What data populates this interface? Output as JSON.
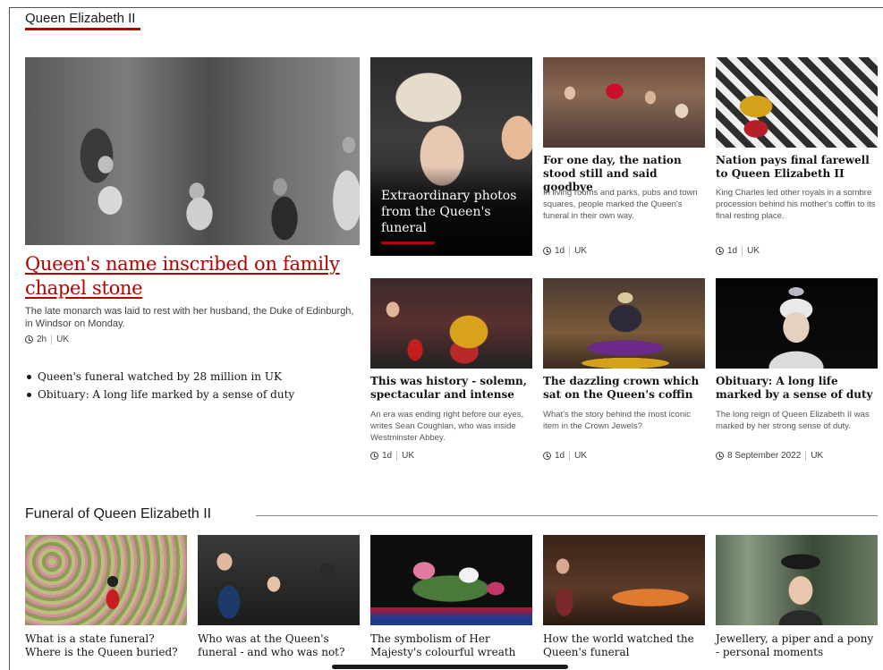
{
  "section": {
    "title": "Queen Elizabeth II"
  },
  "lead": {
    "headline": "Queen's name inscribed on family chapel stone",
    "summary": "The late monarch was laid to rest with her husband, the Duke of Edinburgh, in Windsor on Monday.",
    "time": "2h",
    "tag": "UK",
    "related": [
      "Queen's funeral watched by 28 million in UK",
      "Obituary: A long life marked by a sense of duty"
    ]
  },
  "feature": {
    "title": "Extraordinary photos from the Queen's funeral"
  },
  "cards": [
    {
      "title": "For one day, the nation stood still and said goodbye",
      "summary": "In living rooms and parks, pubs and town squares, people marked the Queen's funeral in their own way.",
      "time": "1d",
      "tag": "UK"
    },
    {
      "title": "Nation pays final farewell to Queen Elizabeth II",
      "summary": "King Charles led other royals in a sombre procession behind his mother's coffin to its final resting place.",
      "time": "1d",
      "tag": "UK"
    },
    {
      "title": "This was history - solemn, spectacular and intense",
      "summary": "An era was ending right before our eyes, writes Sean Coughlan, who was inside Westminster Abbey.",
      "time": "1d",
      "tag": "UK"
    },
    {
      "title": "The dazzling crown which sat on the Queen's coffin",
      "summary": "What's the story behind the most iconic item in the Crown Jewels?",
      "time": "1d",
      "tag": "UK"
    },
    {
      "title": "Obituary: A long life marked by a sense of duty",
      "summary": "The long reign of Queen Elizabeth II was marked by her strong sense of duty.",
      "time": "8 September 2022",
      "tag": "UK"
    }
  ],
  "section2": {
    "title": "Funeral of Queen Elizabeth II",
    "items": [
      {
        "title": "What is a state funeral? Where is the Queen buried?"
      },
      {
        "title": "Who was at the Queen's funeral - and who was not?"
      },
      {
        "title": "The symbolism of Her Majesty's colourful wreath"
      },
      {
        "title": "How the world watched the Queen's funeral"
      },
      {
        "title": "Jewellery, a piper and a pony - personal moments"
      }
    ]
  }
}
